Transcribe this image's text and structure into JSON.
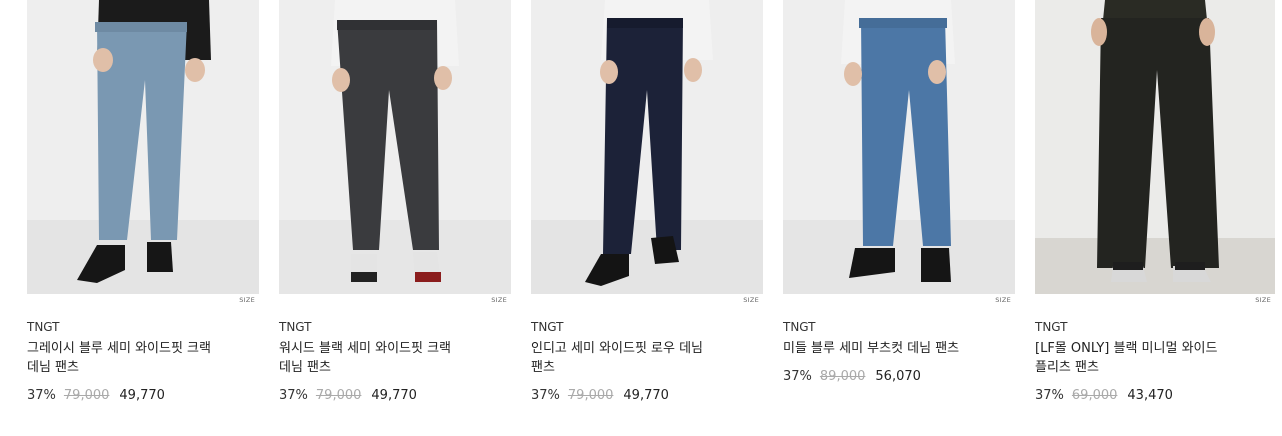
{
  "products": [
    {
      "brand": "TNGT",
      "name_line1": "그레이시 블루 세미 와이드핏 크랙",
      "name_line2": "데님 팬츠",
      "size_label": "SIZE",
      "discount": "37%",
      "original_price": "79,000",
      "sale_price": "49,770",
      "colors": {
        "pants": "#7a98b2",
        "shoes": "#161616",
        "top": "#1b1b1b"
      }
    },
    {
      "brand": "TNGT",
      "name_line1": "워시드 블랙 세미 와이드핏 크랙",
      "name_line2": "데님 팬츠",
      "size_label": "SIZE",
      "discount": "37%",
      "original_price": "79,000",
      "sale_price": "49,770",
      "colors": {
        "pants": "#3a3b3e",
        "shoes": "#e4e4e4",
        "top": "#f3f3f3"
      }
    },
    {
      "brand": "TNGT",
      "name_line1": "인디고 세미 와이드핏 로우 데님",
      "name_line2": "팬츠",
      "size_label": "SIZE",
      "discount": "37%",
      "original_price": "79,000",
      "sale_price": "49,770",
      "colors": {
        "pants": "#1c2238",
        "shoes": "#141414",
        "top": "#f3f3f3"
      }
    },
    {
      "brand": "TNGT",
      "name_line1": "미들 블루 세미 부츠컷 데님 팬츠",
      "name_line2": "",
      "size_label": "SIZE",
      "discount": "37%",
      "original_price": "89,000",
      "sale_price": "56,070",
      "colors": {
        "pants": "#4c77a6",
        "shoes": "#151515",
        "top": "#f3f3f3"
      }
    },
    {
      "brand": "TNGT",
      "name_line1": "[LF몰 ONLY] 블랙 미니멀 와이드",
      "name_line2": "플리츠 팬츠",
      "size_label": "SIZE",
      "discount": "37%",
      "original_price": "69,000",
      "sale_price": "43,470",
      "colors": {
        "pants": "#232420",
        "shoes": "#d8d8d8",
        "top": "#2a2b24"
      }
    }
  ]
}
